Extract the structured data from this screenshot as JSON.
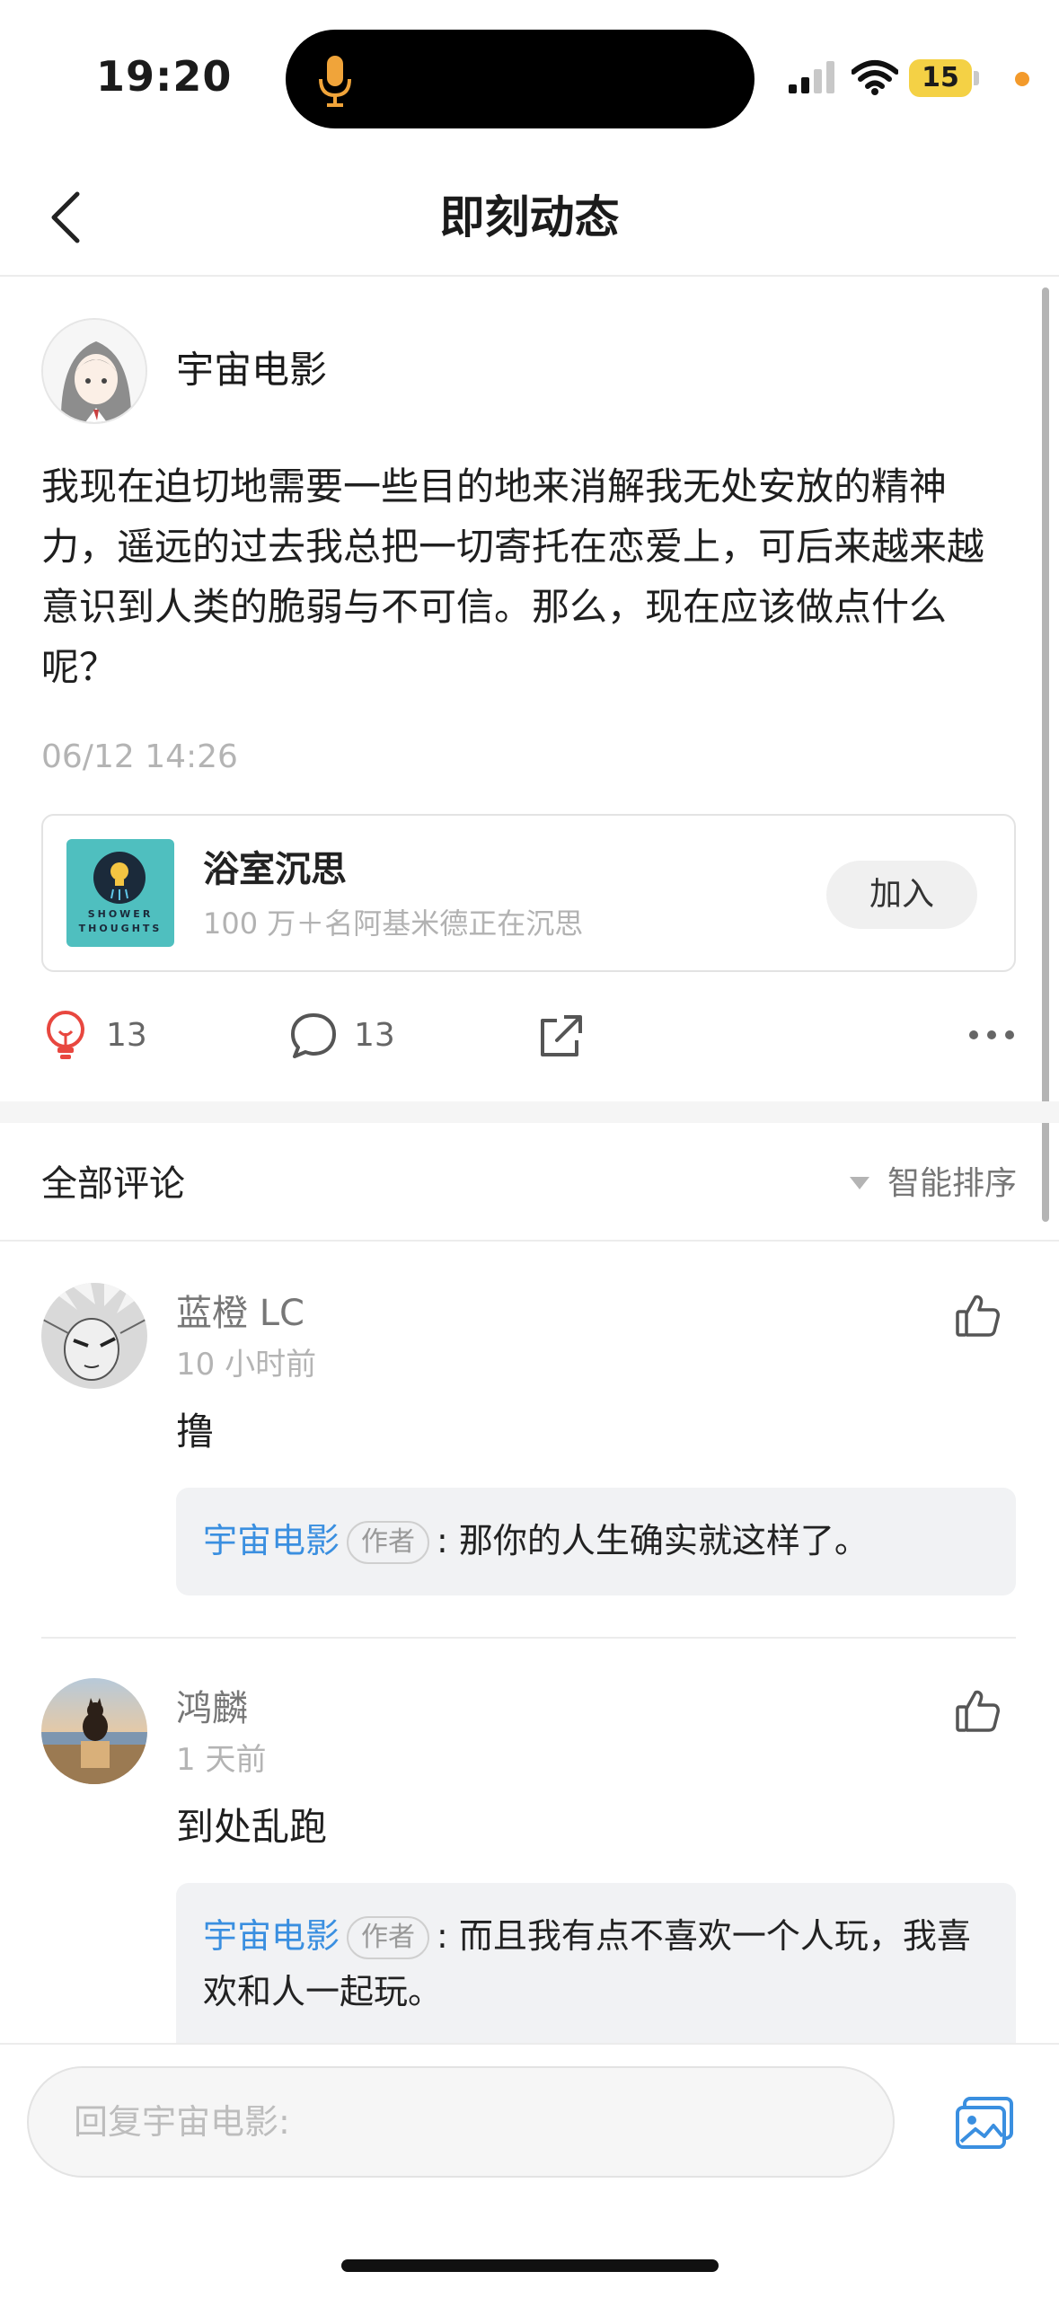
{
  "status_bar": {
    "time": "19:20",
    "battery": "15"
  },
  "nav": {
    "title": "即刻动态"
  },
  "post": {
    "author": "宇宙电影",
    "body": "我现在迫切地需要一些目的地来消解我无处安放的精神力，遥远的过去我总把一切寄托在恋爱上，可后来越来越意识到人类的脆弱与不可信。那么，现在应该做点什么呢？",
    "time": "06/12 14:26",
    "topic": {
      "name": "浴室沉思",
      "subtitle": "100 万＋名阿基米德正在沉思",
      "image_text": "SHOWER THOUGHTS",
      "join_label": "加入"
    },
    "actions": {
      "likes": "13",
      "comments": "13"
    }
  },
  "comments_section": {
    "title": "全部评论",
    "sort_label": "智能排序"
  },
  "comments": [
    {
      "name": "蓝橙 LC",
      "time": "10 小时前",
      "text": "撸",
      "reply": {
        "name": "宇宙电影",
        "tag": "作者",
        "text": ": 那你的人生确实就这样了。"
      }
    },
    {
      "name": "鸿麟",
      "time": "1 天前",
      "text": "到处乱跑",
      "reply": {
        "name": "宇宙电影",
        "tag": "作者",
        "text": ": 而且我有点不喜欢一个人玩，我喜欢和人一起玩。"
      }
    }
  ],
  "reply_bar": {
    "placeholder": "回复宇宙电影:"
  },
  "colors": {
    "accent": "#3a8fe0",
    "like_icon": "#e8473f",
    "battery": "#f4d145"
  }
}
